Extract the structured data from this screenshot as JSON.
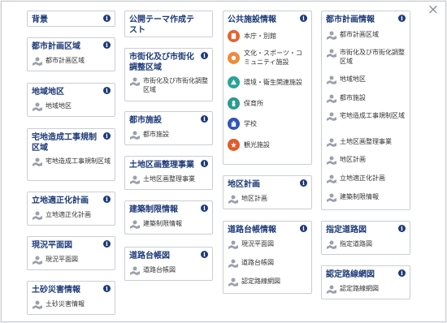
{
  "close_label": "×",
  "info_glyph": "i",
  "cards": {
    "haikei": {
      "title": "背景"
    },
    "toshi_kuiki": {
      "title": "都市計画区域",
      "items": [
        "都市計画区域"
      ]
    },
    "chiiki_chiku": {
      "title": "地域地区",
      "items": [
        "地域地区"
      ]
    },
    "takuchi": {
      "title": "宅地造成工事規制区域",
      "items": [
        "宅地造成工事規制区域"
      ]
    },
    "ritteki": {
      "title": "立地適正化計画",
      "items": [
        "立地適正化計画"
      ]
    },
    "genkyo": {
      "title": "現況平面図",
      "items": [
        "現況平面図"
      ]
    },
    "dosha": {
      "title": "土砂災害情報",
      "items": [
        "土砂災害情報"
      ]
    },
    "koukai_test": {
      "title": "公開テーマ作成テスト"
    },
    "shigaika": {
      "title": "市街化及び市街化調整区域",
      "items": [
        "市街化及び市街化調整区域"
      ]
    },
    "toshi_shisetsu": {
      "title": "都市施設",
      "items": [
        "都市施設"
      ]
    },
    "kukaku": {
      "title": "土地区画整理事業",
      "items": [
        "土地区画整理事業"
      ]
    },
    "kenchiku": {
      "title": "建築制限情報",
      "items": [
        "建築制限情報"
      ]
    },
    "douro_daicho": {
      "title": "道路台帳図",
      "items": [
        "道路台帳図"
      ]
    },
    "koukyou": {
      "title": "公共施設情報",
      "facilities": [
        {
          "label": "本庁・別館",
          "color": "#e8612c",
          "icon": "building-icon"
        },
        {
          "label": "文化・スポーツ・コミュニティ施設",
          "color": "#f08a3c",
          "icon": "culture-icon"
        },
        {
          "label": "環境・衛生関連施設",
          "color": "#2aa39a",
          "icon": "environment-icon"
        },
        {
          "label": "保育所",
          "color": "#2a9b8f",
          "icon": "nursery-icon"
        },
        {
          "label": "学校",
          "color": "#2f55b8",
          "icon": "school-icon"
        },
        {
          "label": "観光施設",
          "color": "#e45a2a",
          "icon": "tourism-icon"
        }
      ]
    },
    "chiku_keikaku": {
      "title": "地区計画",
      "items": [
        "地区計画"
      ]
    },
    "douro_joho": {
      "title": "道路台帳情報",
      "items": [
        "現況平面図",
        "道路台帳図",
        "認定路線網図"
      ]
    },
    "toshi_joho": {
      "title": "都市計画情報",
      "items": [
        "都市計画区域",
        "市街化及び市街化調整区域",
        "地域地区",
        "都市施設",
        "宅地造成工事規制区域",
        "土地区画整理事業",
        "地区計画",
        "立地適正化計画",
        "建築制限情報"
      ]
    },
    "shitei_douro": {
      "title": "指定道路図",
      "items": [
        "指定道路図"
      ]
    },
    "nintei_rosen": {
      "title": "認定路線網図",
      "items": [
        "認定路線網図"
      ]
    }
  }
}
